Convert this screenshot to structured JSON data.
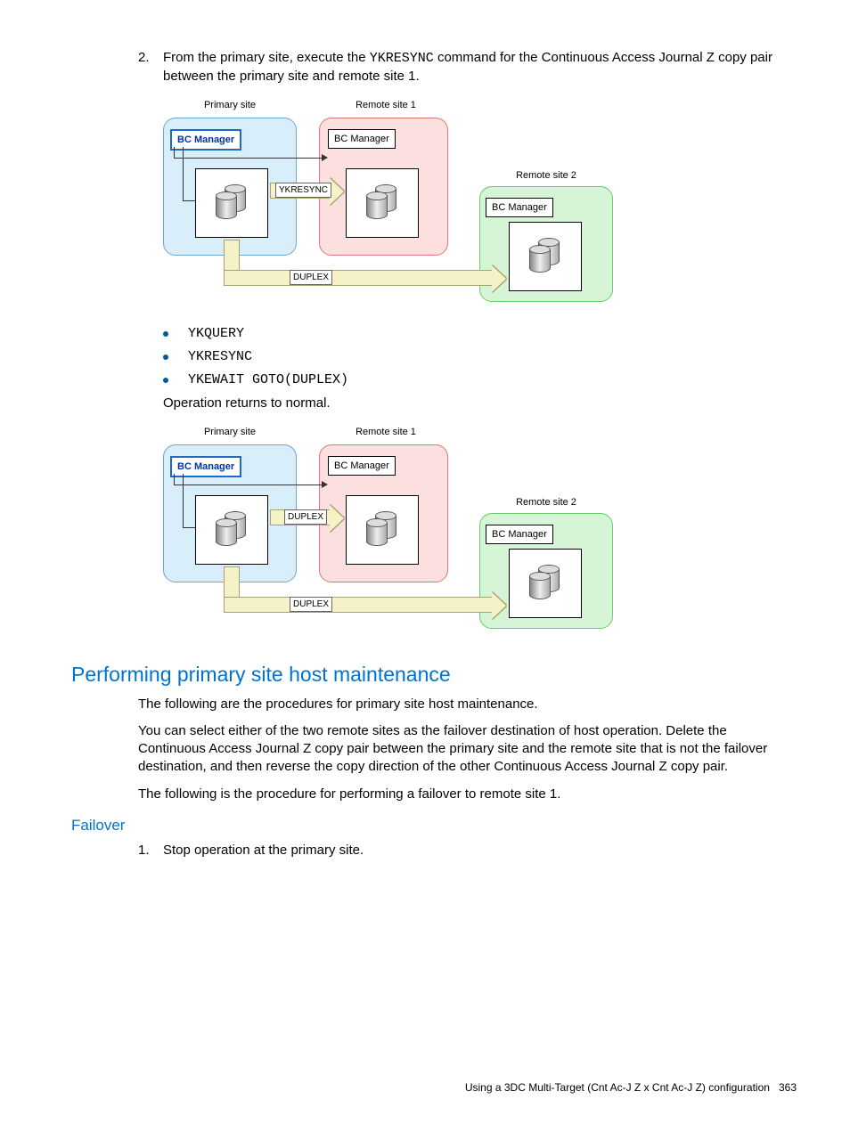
{
  "step2": {
    "num": "2.",
    "text_a": "From the primary site, execute the ",
    "cmd": "YKRESYNC",
    "text_b": " command for the Continuous Access Journal Z copy pair between the primary site and remote site 1."
  },
  "diagram1": {
    "primary": "Primary site",
    "remote1": "Remote site 1",
    "remote2": "Remote site 2",
    "bc": "BC Manager",
    "arrow1": "YKRESYNC",
    "arrow2": "DUPLEX"
  },
  "bullets": {
    "b1": "YKQUERY",
    "b2": "YKRESYNC",
    "b3": "YKEWAIT GOTO(DUPLEX)"
  },
  "after_bullets": "Operation returns to normal.",
  "diagram2": {
    "primary": "Primary site",
    "remote1": "Remote site 1",
    "remote2": "Remote site 2",
    "bc": "BC Manager",
    "arrow1": "DUPLEX",
    "arrow2": "DUPLEX"
  },
  "h2": "Performing primary site host maintenance",
  "p1": "The following are the procedures for primary site host maintenance.",
  "p2": "You can select either of the two remote sites as the failover destination of host operation. Delete the Continuous Access Journal Z copy pair between the primary site and the remote site that is not the failover destination, and then reverse the copy direction of the other Continuous Access Journal Z copy pair.",
  "p3": "The following is the procedure for performing a failover to remote site 1.",
  "h3": "Failover",
  "step_f1": {
    "num": "1.",
    "text": "Stop operation at the primary site."
  },
  "footer": {
    "text": "Using a 3DC Multi-Target (Cnt Ac-J Z x Cnt Ac-J Z) configuration",
    "page": "363"
  }
}
